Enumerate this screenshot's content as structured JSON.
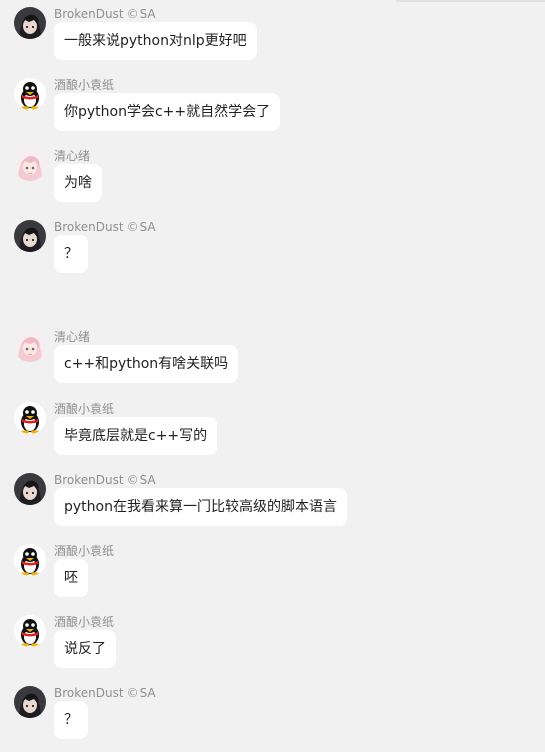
{
  "messages": [
    {
      "sender": "BrokenDust",
      "title": "SA",
      "title_icon": "©",
      "avatar": "anime-dark",
      "text": "一般来说python对nlp更好吧"
    },
    {
      "sender": "酒酿小袁纸",
      "avatar": "penguin",
      "text": "你python学会c++就自然学会了"
    },
    {
      "sender": "清心绪",
      "avatar": "anime-pink",
      "text": "为啥"
    },
    {
      "sender": "BrokenDust",
      "title": "SA",
      "title_icon": "©",
      "avatar": "anime-dark",
      "text": "？"
    },
    {
      "sender": "清心绪",
      "avatar": "anime-pink",
      "text": "c++和python有啥关联吗"
    },
    {
      "sender": "酒酿小袁纸",
      "avatar": "penguin",
      "text": "毕竟底层就是c++写的"
    },
    {
      "sender": "BrokenDust",
      "title": "SA",
      "title_icon": "©",
      "avatar": "anime-dark",
      "text": "python在我看来算一门比较高级的脚本语言"
    },
    {
      "sender": "酒酿小袁纸",
      "avatar": "penguin",
      "text": "呸"
    },
    {
      "sender": "酒酿小袁纸",
      "avatar": "penguin",
      "text": "说反了"
    },
    {
      "sender": "BrokenDust",
      "title": "SA",
      "title_icon": "©",
      "avatar": "anime-dark",
      "text": "？"
    }
  ]
}
